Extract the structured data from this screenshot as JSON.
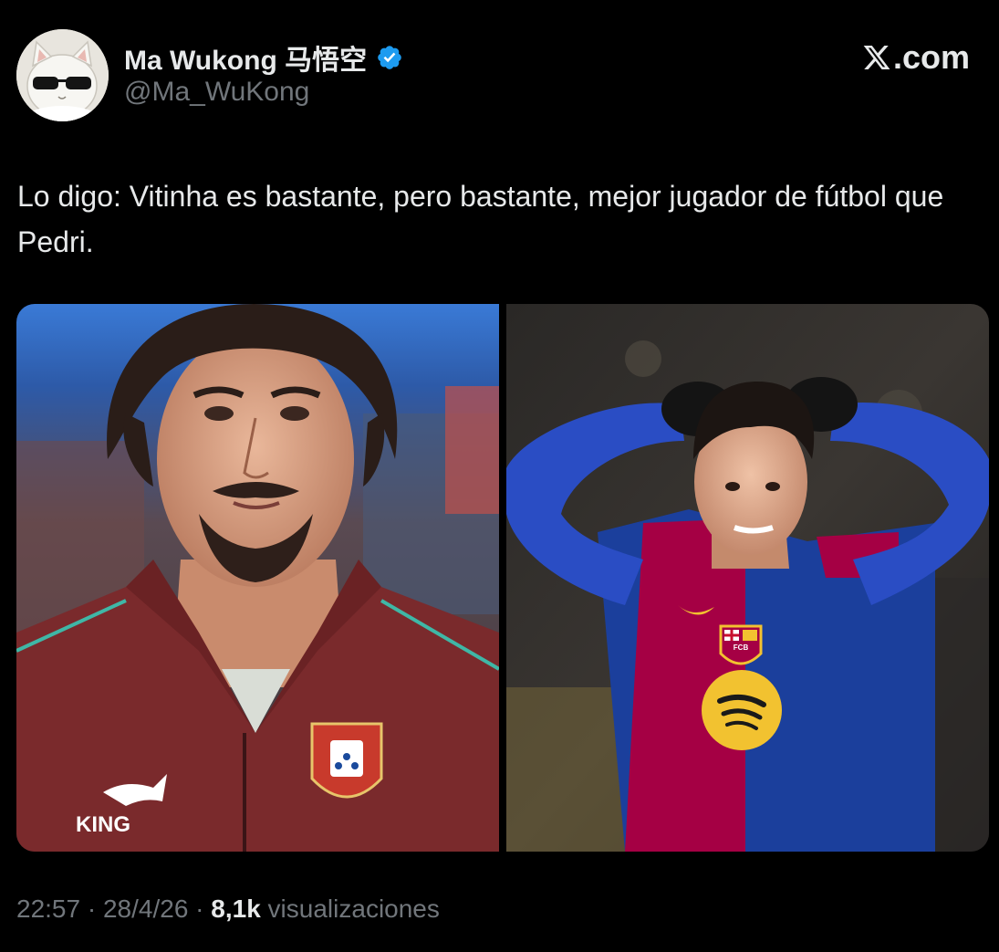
{
  "author": {
    "name": "Ma Wukong 马悟空",
    "handle": "@Ma_WuKong",
    "verified": true,
    "verified_color": "#1d9bf0"
  },
  "site_badge": {
    "logo": "x-logo-icon",
    "label": ".com"
  },
  "tweet": {
    "text": "Lo digo: Vitinha es bastante, pero bastante, mejor jugador de fútbol que Pedri."
  },
  "media": [
    {
      "subject": "player-portrait-portugal-jacket",
      "jacket_text": "KING",
      "jacket_color": "#7a2a2c"
    },
    {
      "subject": "player-barcelona-hands-on-head",
      "crest_text": "FCB",
      "shirt_colors": [
        "#a50044",
        "#1b3f9c"
      ]
    }
  ],
  "meta": {
    "time": "22:57",
    "separator_1": " · ",
    "date": "28/4/26",
    "separator_2": " · ",
    "views_count": "8,1k",
    "views_label": " visualizaciones"
  },
  "colors": {
    "background": "#000000",
    "text_primary": "#e7e9ea",
    "text_secondary": "#71767b"
  }
}
